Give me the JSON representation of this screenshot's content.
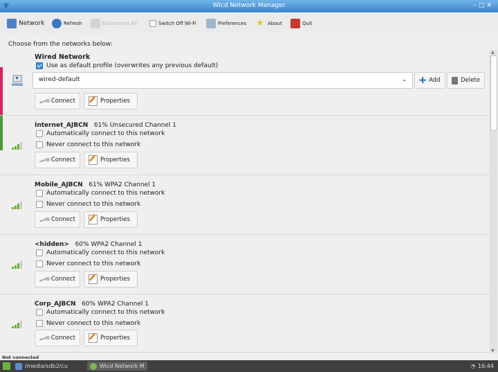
{
  "window": {
    "title": "Wicd Network Manager"
  },
  "toolbar": {
    "network": "Network",
    "refresh": "Refresh",
    "disconnect_all": "Disconnect All",
    "switch_off_wifi": "Switch Off Wi-Fi",
    "preferences": "Preferences",
    "about": "About",
    "quit": "Quit"
  },
  "choose_label": "Choose from the networks below:",
  "wired": {
    "title": "Wired Network",
    "default_profile_label": "Use as default profile (overwrites any previous default)",
    "default_profile_checked": true,
    "profile_value": "wired-default",
    "add_label": "Add",
    "delete_label": "Delete",
    "connect_label": "Connect",
    "properties_label": "Properties"
  },
  "networks": [
    {
      "name": "Internet_AJBCN",
      "info": "61%   Unsecured   Channel 1",
      "auto_label": "Automatically connect to this network",
      "never_label": "Never connect to this network",
      "connect_label": "Connect",
      "properties_label": "Properties",
      "signal_bars": 3
    },
    {
      "name": "Mobile_AJBCN",
      "info": "61%   WPA2   Channel 1",
      "auto_label": "Automatically connect to this network",
      "never_label": "Never connect to this network",
      "connect_label": "Connect",
      "properties_label": "Properties",
      "signal_bars": 3
    },
    {
      "name": "<hidden>",
      "info": "60%   WPA2   Channel 1",
      "auto_label": "Automatically connect to this network",
      "never_label": "Never connect to this network",
      "connect_label": "Connect",
      "properties_label": "Properties",
      "signal_bars": 3
    },
    {
      "name": "Corp_AJBCN",
      "info": "60%   WPA2   Channel 1",
      "auto_label": "Automatically connect to this network",
      "never_label": "Never connect to this network",
      "connect_label": "Connect",
      "properties_label": "Properties",
      "signal_bars": 3
    }
  ],
  "status": "Not connected",
  "taskbar": {
    "path": "/media/sdb2/cu",
    "app": "Wicd Network M",
    "clock": "16:44"
  },
  "colors": {
    "accent": "#3d8edc",
    "signal": "#69b02b"
  }
}
